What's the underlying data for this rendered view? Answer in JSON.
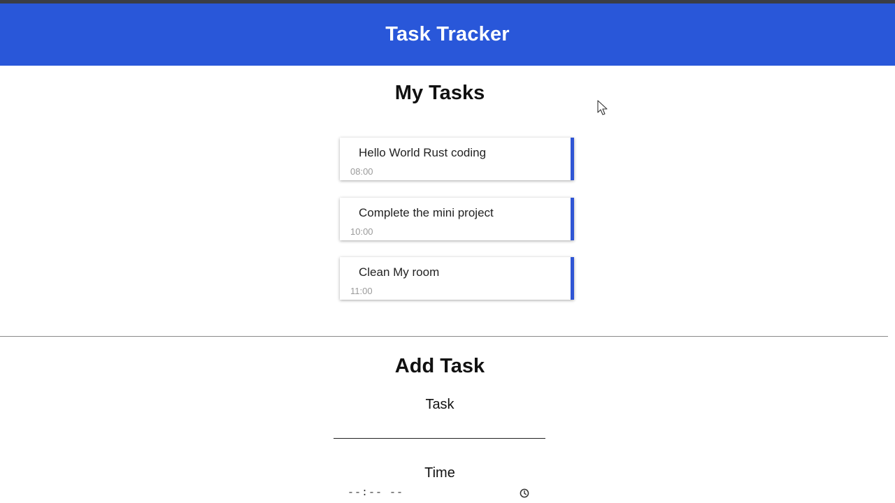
{
  "header": {
    "title": "Task Tracker"
  },
  "my_tasks": {
    "title": "My Tasks",
    "tasks": [
      {
        "text": "Hello World Rust coding",
        "time": "08:00"
      },
      {
        "text": "Complete the mini project",
        "time": "10:00"
      },
      {
        "text": "Clean My room",
        "time": "11:00"
      }
    ]
  },
  "add_task": {
    "title": "Add Task",
    "task_label": "Task",
    "task_value": "",
    "time_label": "Time",
    "time_placeholder": "--:-- --",
    "clock_icon": "clock-icon"
  },
  "colors": {
    "header_bg": "#2957d9",
    "card_accent": "#2f55d4",
    "top_strip": "#3a3d46"
  }
}
